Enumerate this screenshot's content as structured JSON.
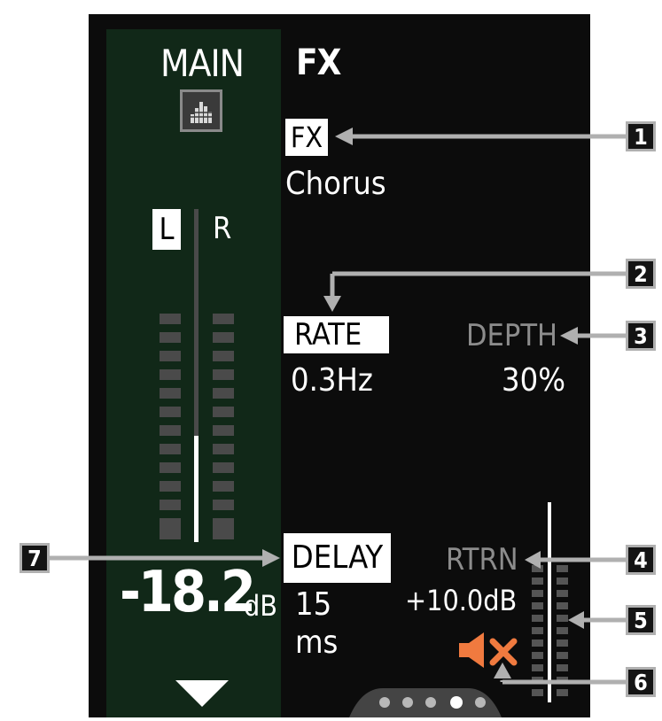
{
  "main": {
    "title": "MAIN",
    "meter_left_label": "L",
    "meter_right_label": "R",
    "level_value": "-18.2",
    "level_unit": "dB",
    "level_fill_fraction": 0.32
  },
  "fx": {
    "title": "FX",
    "fx_label": "FX",
    "fx_value": "Chorus",
    "rate_label": "RATE",
    "rate_value": "0.3Hz",
    "depth_label": "DEPTH",
    "depth_value": "30%",
    "delay_label": "DELAY",
    "delay_value": "15",
    "delay_unit": "ms",
    "rtrn_label": "RTRN",
    "rtrn_value": "+10.0dB"
  },
  "pager": {
    "pages": 5,
    "active": 4
  },
  "callouts": [
    "1",
    "2",
    "3",
    "4",
    "5",
    "6",
    "7"
  ],
  "icons": {
    "main_icon": "eq-bars-icon",
    "mute": "speaker-muted-icon",
    "down": "down-arrow-icon"
  },
  "colors": {
    "background": "#0c0c0c",
    "main_panel": "#112818",
    "mute_orange": "#f07a3f",
    "callout_line": "#b0b0b0"
  }
}
